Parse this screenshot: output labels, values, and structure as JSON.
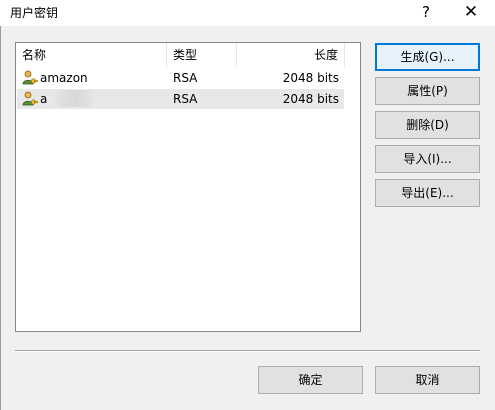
{
  "window": {
    "title": "用户密钥",
    "help_glyph": "?",
    "close_glyph": "✕"
  },
  "list": {
    "columns": [
      "名称",
      "类型",
      "长度"
    ],
    "rows": [
      {
        "name": "amazon",
        "type": "RSA",
        "length": "2048 bits"
      },
      {
        "name": "a",
        "type": "RSA",
        "length": "2048 bits"
      }
    ],
    "icon": "user-key-icon"
  },
  "buttons": {
    "generate": "生成(G)...",
    "properties": "属性(P)",
    "delete": "删除(D)",
    "import": "导入(I)...",
    "export": "导出(E)...",
    "ok": "确定",
    "cancel": "取消"
  },
  "colors": {
    "accent": "#0078d7",
    "selected_row": "#e8e8e8"
  }
}
